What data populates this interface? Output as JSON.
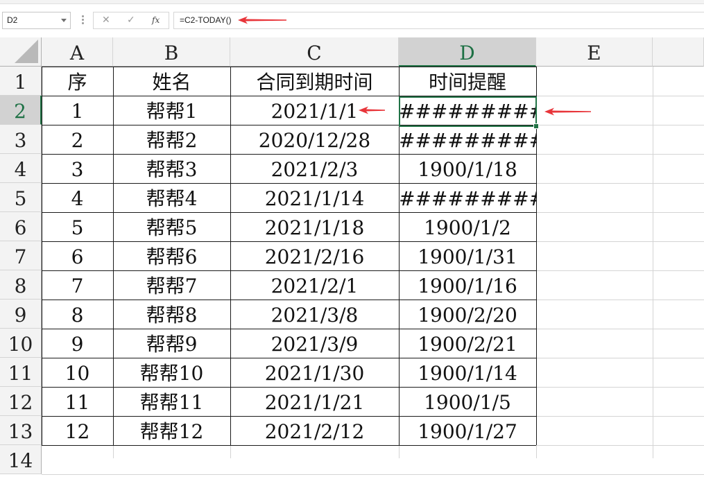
{
  "formula_bar": {
    "name_box": "D2",
    "cancel_symbol": "✕",
    "enter_symbol": "✓",
    "fx_symbol": "fx",
    "formula": "=C2-TODAY()"
  },
  "columns": [
    "A",
    "B",
    "C",
    "D",
    "E"
  ],
  "selected_column": "D",
  "row_numbers": [
    "1",
    "2",
    "3",
    "4",
    "5",
    "6",
    "7",
    "8",
    "9",
    "10",
    "11",
    "12",
    "13",
    "14"
  ],
  "selected_row": "2",
  "header_row": [
    "序",
    "姓名",
    "合同到期时间",
    "时间提醒"
  ],
  "rows": [
    [
      "1",
      "帮帮1",
      "2021/1/1",
      "##########"
    ],
    [
      "2",
      "帮帮2",
      "2020/12/28",
      "##########"
    ],
    [
      "3",
      "帮帮3",
      "2021/2/3",
      "1900/1/18"
    ],
    [
      "4",
      "帮帮4",
      "2021/1/14",
      "##########"
    ],
    [
      "5",
      "帮帮5",
      "2021/1/18",
      "1900/1/2"
    ],
    [
      "6",
      "帮帮6",
      "2021/2/16",
      "1900/1/31"
    ],
    [
      "7",
      "帮帮7",
      "2021/2/1",
      "1900/1/16"
    ],
    [
      "8",
      "帮帮8",
      "2021/3/8",
      "1900/2/20"
    ],
    [
      "9",
      "帮帮9",
      "2021/3/9",
      "1900/2/21"
    ],
    [
      "10",
      "帮帮10",
      "2021/1/30",
      "1900/1/14"
    ],
    [
      "11",
      "帮帮11",
      "2021/1/21",
      "1900/1/5"
    ],
    [
      "12",
      "帮帮12",
      "2021/2/12",
      "1900/1/27"
    ]
  ],
  "annotation_color": "#e8353a",
  "accent_color": "#217346"
}
